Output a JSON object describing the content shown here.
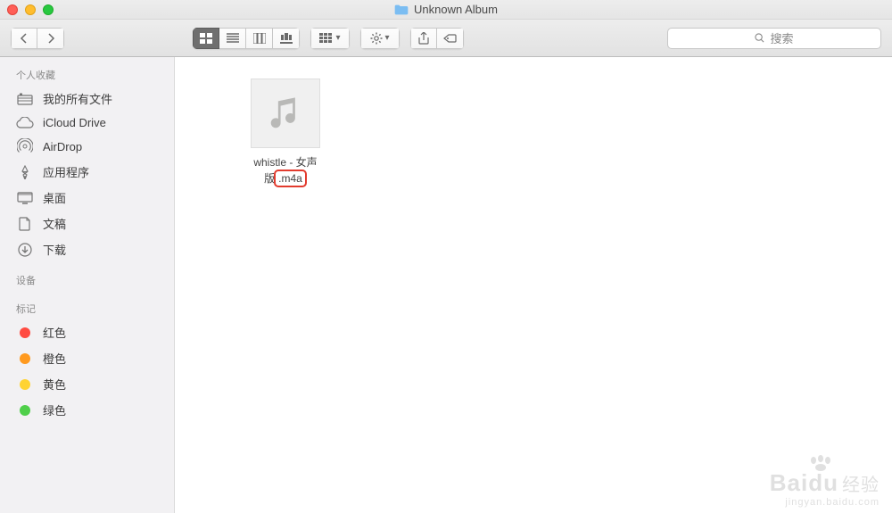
{
  "window": {
    "title": "Unknown Album"
  },
  "search": {
    "placeholder": "搜索"
  },
  "sidebar": {
    "favorites_header": "个人收藏",
    "favorites": [
      {
        "label": "我的所有文件",
        "icon": "all-files-icon"
      },
      {
        "label": "iCloud Drive",
        "icon": "icloud-icon"
      },
      {
        "label": "AirDrop",
        "icon": "airdrop-icon"
      },
      {
        "label": "应用程序",
        "icon": "applications-icon"
      },
      {
        "label": "桌面",
        "icon": "desktop-icon"
      },
      {
        "label": "文稿",
        "icon": "documents-icon"
      },
      {
        "label": "下载",
        "icon": "downloads-icon"
      }
    ],
    "devices_header": "设备",
    "tags_header": "标记",
    "tags": [
      {
        "label": "红色",
        "color": "#ff4b41"
      },
      {
        "label": "橙色",
        "color": "#ff9a1f"
      },
      {
        "label": "黄色",
        "color": "#ffd333"
      },
      {
        "label": "绿色",
        "color": "#4fcf4a"
      }
    ]
  },
  "content": {
    "files": [
      {
        "name_line1": "whistle - 女声",
        "name_line2_prefix": "版",
        "ext_highlight": ".m4a"
      }
    ]
  },
  "watermark": {
    "main": "Bai",
    "du": "du",
    "ch": "经验",
    "sub": "jingyan.baidu.com"
  }
}
